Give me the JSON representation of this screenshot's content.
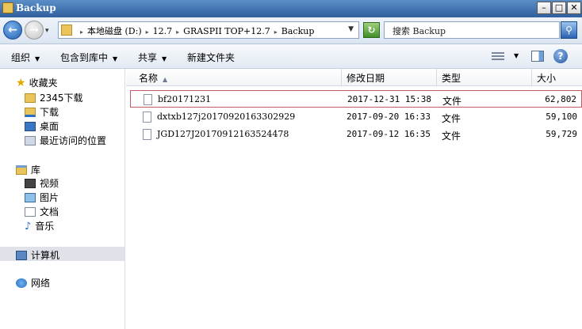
{
  "window": {
    "title": "Backup"
  },
  "address": {
    "crumbs": [
      "本地磁盘 (D:)",
      "12.7",
      "GRASPII TOP+12.7",
      "Backup"
    ]
  },
  "search": {
    "placeholder": "搜索 Backup"
  },
  "toolbar": {
    "organize": "组织",
    "include_in_library": "包含到库中",
    "share": "共享",
    "new_folder": "新建文件夹"
  },
  "nav": {
    "favorites": "收藏夹",
    "fav_2345": "2345下载",
    "fav_download": "下载",
    "fav_desktop": "桌面",
    "fav_recent": "最近访问的位置",
    "libraries": "库",
    "lib_video": "视频",
    "lib_pictures": "图片",
    "lib_docs": "文档",
    "lib_music": "音乐",
    "computer": "计算机",
    "network": "网络"
  },
  "columns": {
    "name": "名称",
    "date": "修改日期",
    "type": "类型",
    "size": "大小"
  },
  "files": [
    {
      "name": "bf20171231",
      "date": "2017-12-31 15:38",
      "type": "文件",
      "size": "62,802"
    },
    {
      "name": "dxtxb127j20170920163302929",
      "date": "2017-09-20 16:33",
      "type": "文件",
      "size": "59,100"
    },
    {
      "name": "JGD127J20170912163524478",
      "date": "2017-09-12 16:35",
      "type": "文件",
      "size": "59,729"
    }
  ],
  "colors": {
    "selection_border": "#c25a66",
    "title_bar": "#2f5f9e"
  }
}
